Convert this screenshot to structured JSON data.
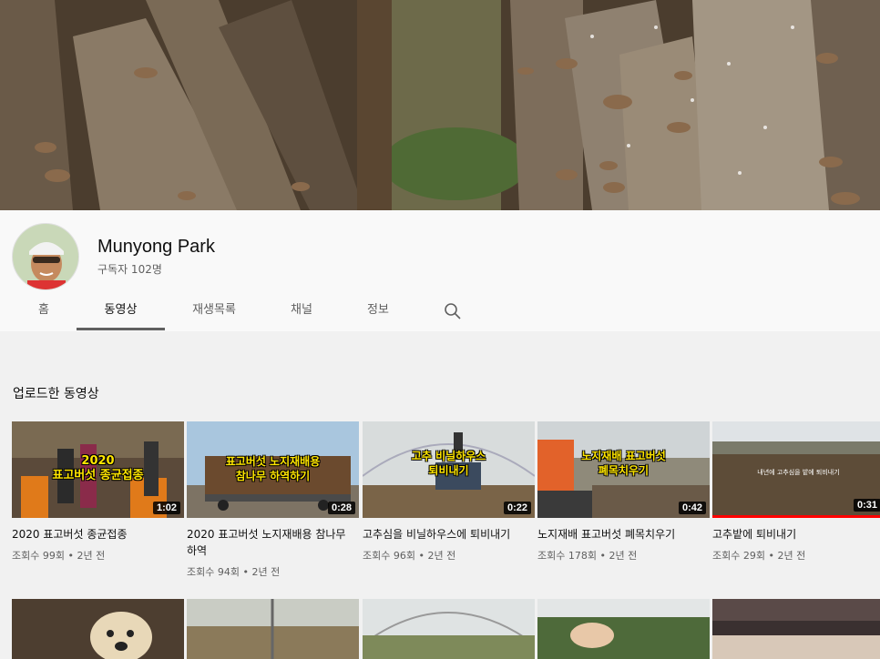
{
  "channel": {
    "name": "Munyong Park",
    "subscribers": "구독자 102명"
  },
  "tabs": [
    {
      "label": "홈"
    },
    {
      "label": "동영상"
    },
    {
      "label": "재생목록"
    },
    {
      "label": "채널"
    },
    {
      "label": "정보"
    }
  ],
  "section": {
    "title": "업로드한 동영상"
  },
  "videos": [
    {
      "title": "2020 표고버섯 종균접종",
      "meta": "조회수 99회 • 2년 전",
      "duration": "1:02",
      "overlay": "2020\n표고버섯 종균접종"
    },
    {
      "title": "2020 표고버섯 노지재배용 참나무하역",
      "meta": "조회수 94회 • 2년 전",
      "duration": "0:28",
      "overlay": "표고버섯 노지재배용\n참나무 하역하기"
    },
    {
      "title": "고추심을 비닐하우스에 퇴비내기",
      "meta": "조회수 96회 • 2년 전",
      "duration": "0:22",
      "overlay": "고추 비닐하우스\n퇴비내기"
    },
    {
      "title": "노지재배 표고버섯 폐목치우기",
      "meta": "조회수 178회 • 2년 전",
      "duration": "0:42",
      "overlay": "노지재배 표고버섯\n폐목치우기"
    },
    {
      "title": "고추밭에 퇴비내기",
      "meta": "조회수 29회 • 2년 전",
      "duration": "0:31",
      "overlay": "내년에 고추심을 밭에 퇴비내기"
    }
  ],
  "colors": {
    "accent": "#ff0000",
    "text_secondary": "#606060"
  },
  "icons": {
    "search": "search-icon"
  }
}
